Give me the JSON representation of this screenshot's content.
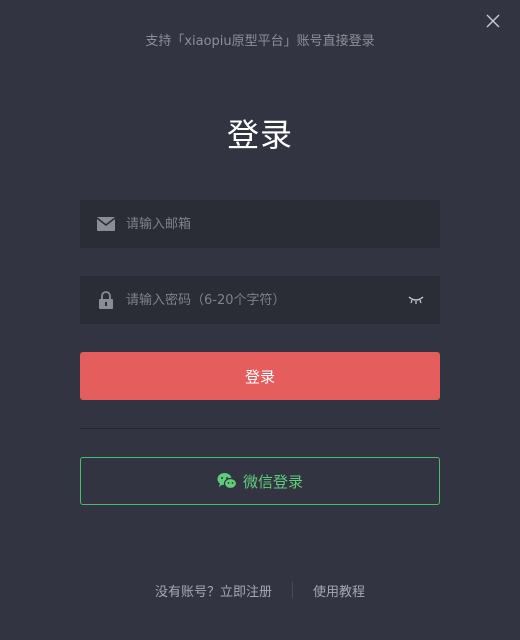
{
  "header": {
    "subtitle": "支持「xiaopiu原型平台」账号直接登录",
    "title": "登录"
  },
  "form": {
    "email_placeholder": "请输入邮箱",
    "password_placeholder": "请输入密码（6-20个字符）",
    "login_label": "登录",
    "wechat_label": "微信登录"
  },
  "footer": {
    "register_label": "没有账号？立即注册",
    "tutorial_label": "使用教程"
  },
  "icons": {
    "close": "close-icon",
    "email": "mail-icon",
    "password": "lock-icon",
    "toggle_password": "eye-closed-icon",
    "wechat": "wechat-icon"
  },
  "colors": {
    "background": "#323541",
    "field": "#2a2c36",
    "primary": "#e65d5d",
    "wechat": "#4dbb6c"
  }
}
